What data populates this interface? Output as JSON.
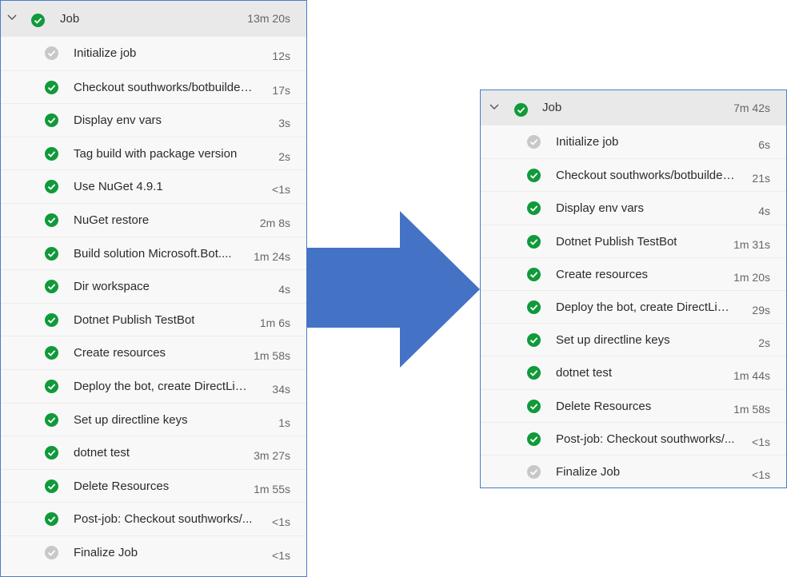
{
  "left_job": {
    "title": "Job",
    "duration": "13m 20s",
    "steps": [
      {
        "name": "Initialize job",
        "duration": "12s",
        "status": "skipped"
      },
      {
        "name": "Checkout southworks/botbuilder...",
        "duration": "17s",
        "status": "success"
      },
      {
        "name": "Display env vars",
        "duration": "3s",
        "status": "success"
      },
      {
        "name": "Tag build with package version",
        "duration": "2s",
        "status": "success"
      },
      {
        "name": "Use NuGet 4.9.1",
        "duration": "<1s",
        "status": "success"
      },
      {
        "name": "NuGet restore",
        "duration": "2m 8s",
        "status": "success"
      },
      {
        "name": "Build solution Microsoft.Bot....",
        "duration": "1m 24s",
        "status": "success"
      },
      {
        "name": "Dir workspace",
        "duration": "4s",
        "status": "success"
      },
      {
        "name": "Dotnet Publish TestBot",
        "duration": "1m 6s",
        "status": "success"
      },
      {
        "name": "Create resources",
        "duration": "1m 58s",
        "status": "success"
      },
      {
        "name": "Deploy the bot, create DirectLine...",
        "duration": "34s",
        "status": "success"
      },
      {
        "name": "Set up directline keys",
        "duration": "1s",
        "status": "success"
      },
      {
        "name": "dotnet test",
        "duration": "3m 27s",
        "status": "success"
      },
      {
        "name": "Delete Resources",
        "duration": "1m 55s",
        "status": "success"
      },
      {
        "name": "Post-job: Checkout southworks/...",
        "duration": "<1s",
        "status": "success"
      },
      {
        "name": "Finalize Job",
        "duration": "<1s",
        "status": "skipped"
      }
    ]
  },
  "right_job": {
    "title": "Job",
    "duration": "7m 42s",
    "steps": [
      {
        "name": "Initialize job",
        "duration": "6s",
        "status": "skipped"
      },
      {
        "name": "Checkout southworks/botbuilder...",
        "duration": "21s",
        "status": "success"
      },
      {
        "name": "Display env vars",
        "duration": "4s",
        "status": "success"
      },
      {
        "name": "Dotnet Publish TestBot",
        "duration": "1m 31s",
        "status": "success"
      },
      {
        "name": "Create resources",
        "duration": "1m 20s",
        "status": "success"
      },
      {
        "name": "Deploy the bot, create DirectLine...",
        "duration": "29s",
        "status": "success"
      },
      {
        "name": "Set up directline keys",
        "duration": "2s",
        "status": "success"
      },
      {
        "name": "dotnet test",
        "duration": "1m 44s",
        "status": "success"
      },
      {
        "name": "Delete Resources",
        "duration": "1m 58s",
        "status": "success"
      },
      {
        "name": "Post-job: Checkout southworks/...",
        "duration": "<1s",
        "status": "success"
      },
      {
        "name": "Finalize Job",
        "duration": "<1s",
        "status": "skipped"
      }
    ]
  },
  "colors": {
    "success": "#109a3a",
    "skipped": "#c8c8c8",
    "arrow": "#4472c4",
    "panel_border": "#4a7cc7"
  },
  "icons": {
    "collapse": "chevron-down-icon",
    "success": "check-circle-icon",
    "skipped": "check-circle-gray-icon"
  }
}
